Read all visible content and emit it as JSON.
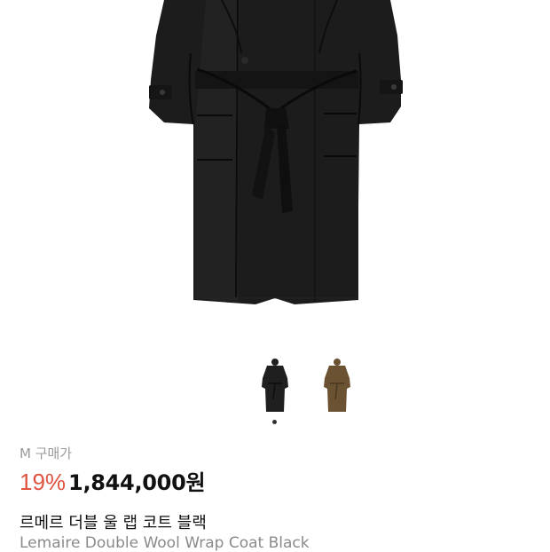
{
  "product": {
    "main_image": "black-wrap-coat-photo",
    "thumbnails": [
      {
        "name": "black-coat-thumbnail",
        "color": "#1f1f1f",
        "selected": true
      },
      {
        "name": "brown-coat-thumbnail",
        "color": "#6a5232",
        "selected": false
      }
    ],
    "purchase_label": "M 구매가",
    "discount": "19%",
    "price": "1,844,000원",
    "title_ko": "르메르 더블 울 랩 코트 블랙",
    "title_en": "Lemaire Double Wool Wrap Coat Black"
  },
  "colors": {
    "discount": "#e0533f",
    "price": "#111111",
    "label": "#9a9a9a",
    "subtitle": "#8a8a8a",
    "coat_black": "#1f1f1f",
    "coat_brown": "#6a5232"
  }
}
